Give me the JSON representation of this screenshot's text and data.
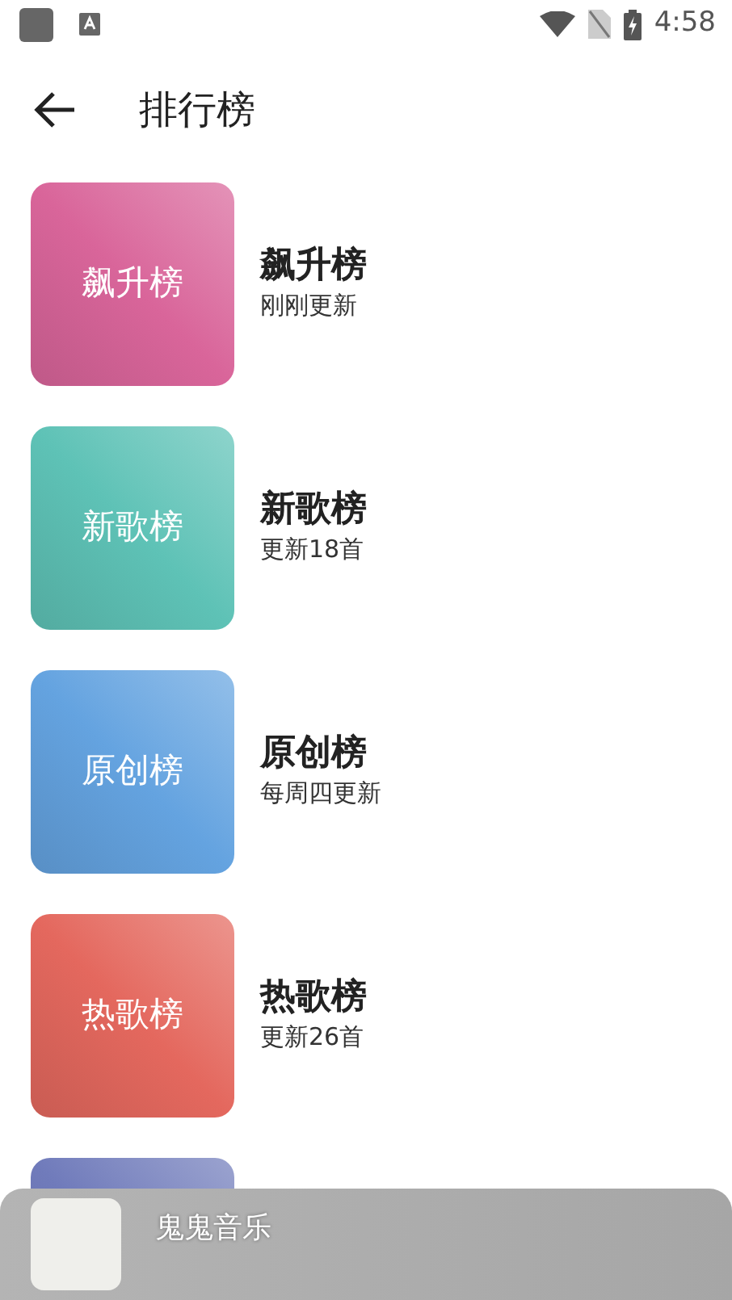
{
  "status_bar": {
    "time": "4:58"
  },
  "header": {
    "title": "排行榜"
  },
  "charts": [
    {
      "cover_label": "飙升榜",
      "title": "飙升榜",
      "subtitle": "刚刚更新",
      "color": "#d9659a"
    },
    {
      "cover_label": "新歌榜",
      "title": "新歌榜",
      "subtitle": "更新18首",
      "color": "#5ec2b6"
    },
    {
      "cover_label": "原创榜",
      "title": "原创榜",
      "subtitle": "每周四更新",
      "color": "#64a3e0"
    },
    {
      "cover_label": "热歌榜",
      "title": "热歌榜",
      "subtitle": "更新26首",
      "color": "#e4685e"
    },
    {
      "color": "#707bbb"
    }
  ],
  "player": {
    "title": "鬼鬼音乐"
  }
}
